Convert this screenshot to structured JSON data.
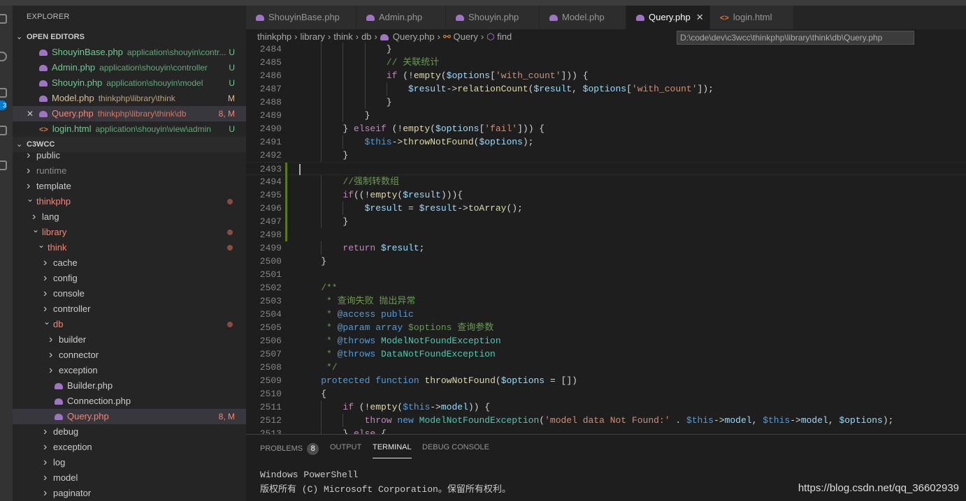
{
  "activity": {
    "badge": "3"
  },
  "sidebar": {
    "title": "EXPLORER",
    "open_editors_label": "OPEN EDITORS",
    "open_editors": [
      {
        "name": "ShouyinBase.php",
        "desc": "application\\shouyin\\contr...",
        "status": "U",
        "color": "green",
        "icon": "php"
      },
      {
        "name": "Admin.php",
        "desc": "application\\shouyin\\controller",
        "status": "U",
        "color": "green",
        "icon": "php"
      },
      {
        "name": "Shouyin.php",
        "desc": "application\\shouyin\\model",
        "status": "U",
        "color": "green",
        "icon": "php"
      },
      {
        "name": "Model.php",
        "desc": "thinkphp\\library\\think",
        "status": "M",
        "color": "yellow",
        "icon": "php"
      },
      {
        "name": "Query.php",
        "desc": "thinkphp\\library\\think\\db",
        "status": "8, M",
        "color": "red",
        "icon": "php",
        "close": "✕"
      },
      {
        "name": "login.html",
        "desc": "application\\shouyin\\view\\admin",
        "status": "U",
        "color": "green",
        "icon": "html"
      }
    ],
    "workspace_label": "C3WCC",
    "tree": [
      {
        "name": "public",
        "depth": 0,
        "type": "folder",
        "open": false,
        "color": "white"
      },
      {
        "name": "runtime",
        "depth": 0,
        "type": "folder",
        "open": false,
        "color": "gray"
      },
      {
        "name": "template",
        "depth": 0,
        "type": "folder",
        "open": false,
        "color": "white"
      },
      {
        "name": "thinkphp",
        "depth": 0,
        "type": "folder",
        "open": true,
        "color": "red",
        "dot": true
      },
      {
        "name": "lang",
        "depth": 1,
        "type": "folder",
        "open": false,
        "color": "white"
      },
      {
        "name": "library",
        "depth": 1,
        "type": "folder",
        "open": true,
        "color": "red",
        "dot": true
      },
      {
        "name": "think",
        "depth": 2,
        "type": "folder",
        "open": true,
        "color": "red",
        "dot": true
      },
      {
        "name": "cache",
        "depth": 3,
        "type": "folder",
        "open": false,
        "color": "white"
      },
      {
        "name": "config",
        "depth": 3,
        "type": "folder",
        "open": false,
        "color": "white"
      },
      {
        "name": "console",
        "depth": 3,
        "type": "folder",
        "open": false,
        "color": "white"
      },
      {
        "name": "controller",
        "depth": 3,
        "type": "folder",
        "open": false,
        "color": "white"
      },
      {
        "name": "db",
        "depth": 3,
        "type": "folder",
        "open": true,
        "color": "red",
        "dot": true
      },
      {
        "name": "builder",
        "depth": 4,
        "type": "folder",
        "open": false,
        "color": "white"
      },
      {
        "name": "connector",
        "depth": 4,
        "type": "folder",
        "open": false,
        "color": "white"
      },
      {
        "name": "exception",
        "depth": 4,
        "type": "folder",
        "open": false,
        "color": "white"
      },
      {
        "name": "Builder.php",
        "depth": 4,
        "type": "php",
        "color": "white"
      },
      {
        "name": "Connection.php",
        "depth": 4,
        "type": "php",
        "color": "white"
      },
      {
        "name": "Query.php",
        "depth": 4,
        "type": "php",
        "color": "red",
        "status": "8, M",
        "selected": true
      },
      {
        "name": "debug",
        "depth": 3,
        "type": "folder",
        "open": false,
        "color": "white"
      },
      {
        "name": "exception",
        "depth": 3,
        "type": "folder",
        "open": false,
        "color": "white"
      },
      {
        "name": "log",
        "depth": 3,
        "type": "folder",
        "open": false,
        "color": "white"
      },
      {
        "name": "model",
        "depth": 3,
        "type": "folder",
        "open": false,
        "color": "white"
      },
      {
        "name": "paginator",
        "depth": 3,
        "type": "folder",
        "open": false,
        "color": "white"
      }
    ]
  },
  "tabs": [
    {
      "label": "ShouyinBase.php",
      "icon": "php"
    },
    {
      "label": "Admin.php",
      "icon": "php"
    },
    {
      "label": "Shouyin.php",
      "icon": "php"
    },
    {
      "label": "Model.php",
      "icon": "php"
    },
    {
      "label": "Query.php",
      "icon": "php",
      "active": true,
      "close": "✕"
    },
    {
      "label": "login.html",
      "icon": "html"
    }
  ],
  "breadcrumb": [
    "thinkphp",
    "library",
    "think",
    "db",
    "Query.php",
    "Query",
    "find"
  ],
  "tooltip": "D:\\code\\dev\\c3wcc\\thinkphp\\library\\think\\db\\Query.php",
  "code": [
    {
      "n": "2484",
      "i": 16,
      "t": [
        [
          "}",
          "pl"
        ]
      ]
    },
    {
      "n": "2485",
      "i": 16,
      "t": [
        [
          "// 关联统计",
          "cm"
        ]
      ]
    },
    {
      "n": "2486",
      "i": 16,
      "t": [
        [
          "if",
          "kw"
        ],
        [
          " (!",
          "pl"
        ],
        [
          "empty",
          "fn"
        ],
        [
          "(",
          "pl"
        ],
        [
          "$options",
          "var"
        ],
        [
          "[",
          "pl"
        ],
        [
          "'with_count'",
          "str"
        ],
        [
          "])) {",
          "pl"
        ]
      ]
    },
    {
      "n": "2487",
      "i": 20,
      "t": [
        [
          "$result",
          "var"
        ],
        [
          "->",
          "pl"
        ],
        [
          "relationCount",
          "fn"
        ],
        [
          "(",
          "pl"
        ],
        [
          "$result",
          "var"
        ],
        [
          ", ",
          "pl"
        ],
        [
          "$options",
          "var"
        ],
        [
          "[",
          "pl"
        ],
        [
          "'with_count'",
          "str"
        ],
        [
          "]);",
          "pl"
        ]
      ]
    },
    {
      "n": "2488",
      "i": 16,
      "t": [
        [
          "}",
          "pl"
        ]
      ]
    },
    {
      "n": "2489",
      "i": 12,
      "t": [
        [
          "}",
          "pl"
        ]
      ]
    },
    {
      "n": "2490",
      "i": 8,
      "t": [
        [
          "} ",
          "pl"
        ],
        [
          "elseif",
          "kw"
        ],
        [
          " (!",
          "pl"
        ],
        [
          "empty",
          "fn"
        ],
        [
          "(",
          "pl"
        ],
        [
          "$options",
          "var"
        ],
        [
          "[",
          "pl"
        ],
        [
          "'fail'",
          "str"
        ],
        [
          "])) {",
          "pl"
        ]
      ]
    },
    {
      "n": "2491",
      "i": 12,
      "t": [
        [
          "$this",
          "th"
        ],
        [
          "->",
          "pl"
        ],
        [
          "throwNotFound",
          "fn"
        ],
        [
          "(",
          "pl"
        ],
        [
          "$options",
          "var"
        ],
        [
          ");",
          "pl"
        ]
      ]
    },
    {
      "n": "2492",
      "i": 8,
      "t": [
        [
          "}",
          "pl"
        ]
      ]
    },
    {
      "n": "2493",
      "i": 0,
      "t": [],
      "current": true,
      "mod": true
    },
    {
      "n": "2494",
      "i": 8,
      "t": [
        [
          "//强制转数组",
          "cm"
        ]
      ],
      "mod": true
    },
    {
      "n": "2495",
      "i": 8,
      "t": [
        [
          "if",
          "kw"
        ],
        [
          "((!",
          "pl"
        ],
        [
          "empty",
          "fn"
        ],
        [
          "(",
          "pl"
        ],
        [
          "$result",
          "var"
        ],
        [
          "))){",
          "pl"
        ]
      ],
      "mod": true
    },
    {
      "n": "2496",
      "i": 12,
      "t": [
        [
          "$result",
          "var"
        ],
        [
          " = ",
          "pl"
        ],
        [
          "$result",
          "var"
        ],
        [
          "->",
          "pl"
        ],
        [
          "toArray",
          "fn"
        ],
        [
          "();",
          "pl"
        ]
      ],
      "mod": true
    },
    {
      "n": "2497",
      "i": 8,
      "t": [
        [
          "}",
          "pl"
        ]
      ],
      "mod": true
    },
    {
      "n": "2498",
      "i": 0,
      "t": [],
      "mod": true
    },
    {
      "n": "2499",
      "i": 8,
      "t": [
        [
          "return",
          "kw"
        ],
        [
          " ",
          "pl"
        ],
        [
          "$result",
          "var"
        ],
        [
          ";",
          "pl"
        ]
      ]
    },
    {
      "n": "2500",
      "i": 4,
      "t": [
        [
          "}",
          "pl"
        ]
      ]
    },
    {
      "n": "2501",
      "i": 0,
      "t": []
    },
    {
      "n": "2502",
      "i": 4,
      "t": [
        [
          "/**",
          "cm"
        ]
      ]
    },
    {
      "n": "2503",
      "i": 4,
      "t": [
        [
          " * 查询失败 抛出异常",
          "cm"
        ]
      ]
    },
    {
      "n": "2504",
      "i": 4,
      "t": [
        [
          " * ",
          "cm"
        ],
        [
          "@access",
          "st2"
        ],
        [
          " ",
          "cm"
        ],
        [
          "public",
          "st2"
        ]
      ]
    },
    {
      "n": "2505",
      "i": 4,
      "t": [
        [
          " * ",
          "cm"
        ],
        [
          "@param",
          "st2"
        ],
        [
          " ",
          "cm"
        ],
        [
          "array",
          "st2"
        ],
        [
          " $options 查询参数",
          "cm"
        ]
      ]
    },
    {
      "n": "2506",
      "i": 4,
      "t": [
        [
          " * ",
          "cm"
        ],
        [
          "@throws",
          "st2"
        ],
        [
          " ",
          "cm"
        ],
        [
          "ModelNotFoundException",
          "ty"
        ]
      ]
    },
    {
      "n": "2507",
      "i": 4,
      "t": [
        [
          " * ",
          "cm"
        ],
        [
          "@throws",
          "st2"
        ],
        [
          " ",
          "cm"
        ],
        [
          "DataNotFoundException",
          "ty"
        ]
      ]
    },
    {
      "n": "2508",
      "i": 4,
      "t": [
        [
          " */",
          "cm"
        ]
      ]
    },
    {
      "n": "2509",
      "i": 4,
      "t": [
        [
          "protected",
          "st2"
        ],
        [
          " ",
          "pl"
        ],
        [
          "function",
          "st2"
        ],
        [
          " ",
          "pl"
        ],
        [
          "throwNotFound",
          "fn"
        ],
        [
          "(",
          "pl"
        ],
        [
          "$options",
          "var"
        ],
        [
          " = [])",
          "pl"
        ]
      ]
    },
    {
      "n": "2510",
      "i": 4,
      "t": [
        [
          "{",
          "pl"
        ]
      ]
    },
    {
      "n": "2511",
      "i": 8,
      "t": [
        [
          "if",
          "kw"
        ],
        [
          " (!",
          "pl"
        ],
        [
          "empty",
          "fn"
        ],
        [
          "(",
          "pl"
        ],
        [
          "$this",
          "th"
        ],
        [
          "->",
          "pl"
        ],
        [
          "model",
          "var"
        ],
        [
          ")) {",
          "pl"
        ]
      ]
    },
    {
      "n": "2512",
      "i": 12,
      "t": [
        [
          "throw",
          "kw"
        ],
        [
          " ",
          "pl"
        ],
        [
          "new",
          "st2"
        ],
        [
          " ",
          "pl"
        ],
        [
          "ModelNotFoundException",
          "ty"
        ],
        [
          "(",
          "pl"
        ],
        [
          "'model data Not Found:'",
          "str"
        ],
        [
          " . ",
          "pl"
        ],
        [
          "$this",
          "th"
        ],
        [
          "->",
          "pl"
        ],
        [
          "model",
          "var"
        ],
        [
          ", ",
          "pl"
        ],
        [
          "$this",
          "th"
        ],
        [
          "->",
          "pl"
        ],
        [
          "model",
          "var"
        ],
        [
          ", ",
          "pl"
        ],
        [
          "$options",
          "var"
        ],
        [
          ");",
          "pl"
        ]
      ]
    },
    {
      "n": "2513",
      "i": 8,
      "t": [
        [
          "} ",
          "pl"
        ],
        [
          "else",
          "kw"
        ],
        [
          " {",
          "pl"
        ]
      ]
    }
  ],
  "panel": {
    "tabs": [
      {
        "label": "PROBLEMS",
        "badge": "8"
      },
      {
        "label": "OUTPUT"
      },
      {
        "label": "TERMINAL",
        "active": true
      },
      {
        "label": "DEBUG CONSOLE"
      }
    ],
    "terminal": [
      "Windows PowerShell",
      "版权所有 (C) Microsoft Corporation。保留所有权利。"
    ]
  },
  "watermark": "https://blog.csdn.net/qq_36602939"
}
